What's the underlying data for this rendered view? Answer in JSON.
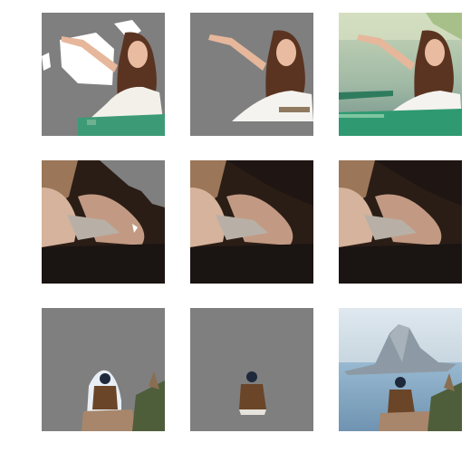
{
  "figure": {
    "background": "#ffffff",
    "mask_gray": "#7f7f7f",
    "rows": [
      {
        "subject": "woman-with-raised-arm",
        "panels": [
          "segmentation-mask-a",
          "segmentation-mask-b",
          "original-photo"
        ]
      },
      {
        "subject": "close-up-hands",
        "panels": [
          "segmentation-mask-a",
          "segmentation-mask-b",
          "original-photo"
        ]
      },
      {
        "subject": "man-sitting-by-sea",
        "panels": [
          "segmentation-mask-a",
          "segmentation-mask-b",
          "original-photo"
        ]
      }
    ]
  }
}
